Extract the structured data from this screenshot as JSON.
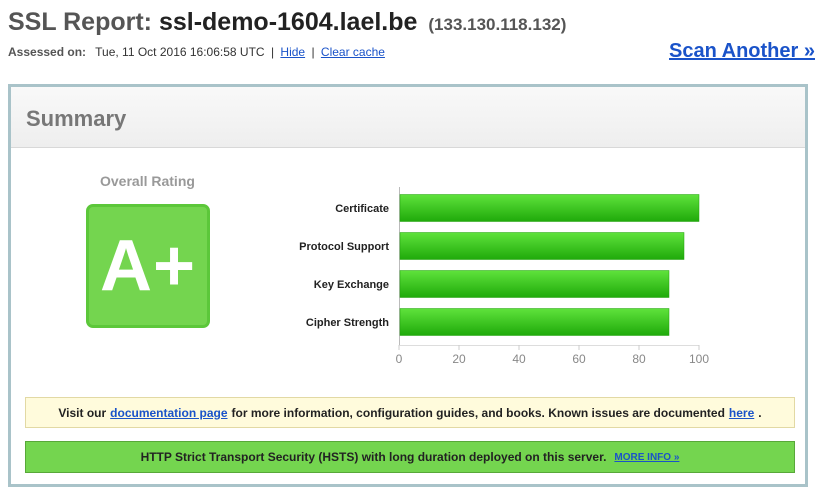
{
  "header": {
    "title_label": "SSL Report:",
    "hostname": "ssl-demo-1604.lael.be",
    "ip": "(133.130.118.132)",
    "assessed_label": "Assessed on:",
    "assessed_value": "Tue, 11 Oct 2016 16:06:58 UTC",
    "separator": "|",
    "hide_link": "Hide",
    "clear_cache_link": "Clear cache",
    "scan_another": "Scan Another »"
  },
  "summary": {
    "title": "Summary",
    "overall_label": "Overall Rating",
    "grade": "A+",
    "colors": {
      "grade_bg": "#74d54f",
      "bar": "#2ec410",
      "link": "#1a53c9"
    }
  },
  "chart_data": {
    "type": "bar",
    "orientation": "horizontal",
    "categories": [
      "Certificate",
      "Protocol Support",
      "Key Exchange",
      "Cipher Strength"
    ],
    "values": [
      100,
      95,
      90,
      90
    ],
    "xlim": [
      0,
      100
    ],
    "xticks": [
      0,
      20,
      40,
      60,
      80,
      100
    ],
    "grid": false,
    "legend": "none",
    "title": "",
    "xlabel": "",
    "ylabel": ""
  },
  "notice": {
    "text_before": "Visit our",
    "doc_link": "documentation page",
    "text_middle": "for more information, configuration guides, and books. Known issues are documented",
    "here_link": "here",
    "text_after": "."
  },
  "hsts": {
    "text": "HTTP Strict Transport Security (HSTS) with long duration deployed on this server.",
    "more_link": "MORE INFO »"
  }
}
